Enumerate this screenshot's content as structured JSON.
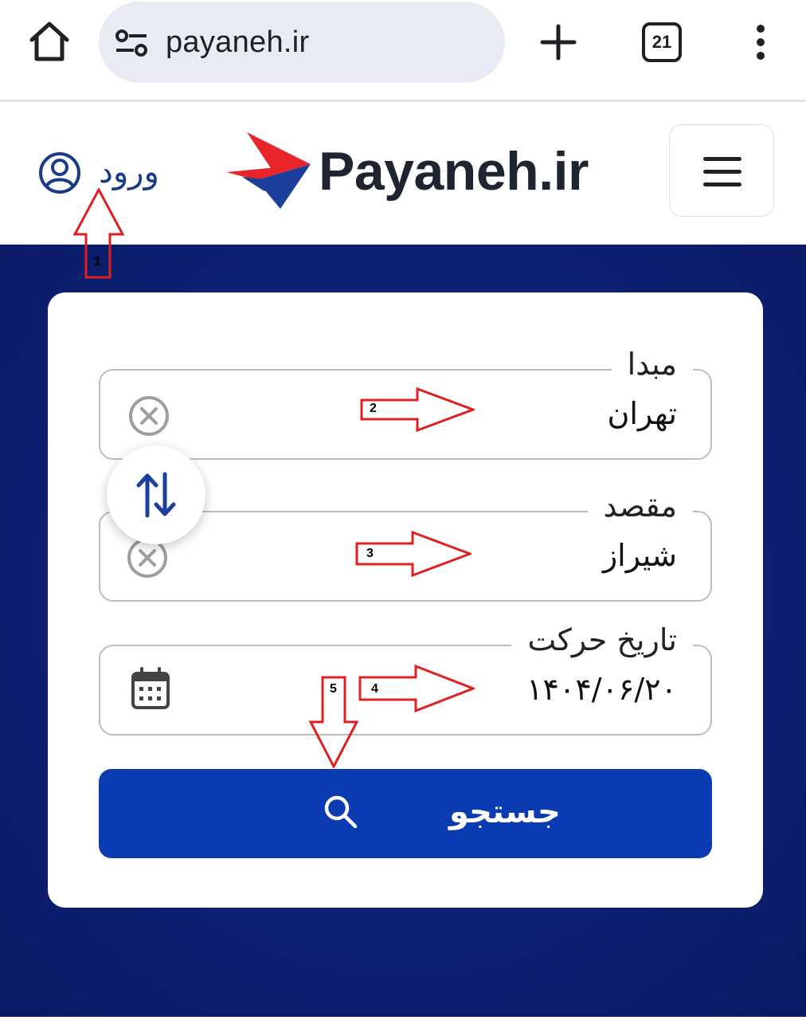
{
  "browser": {
    "url": "payaneh.ir",
    "tab_count": "21"
  },
  "header": {
    "login_label": "ورود",
    "logo_text": "Payaneh.ir"
  },
  "form": {
    "origin_label": "مبدا",
    "origin_value": "تهران",
    "destination_label": "مقصد",
    "destination_value": "شیراز",
    "date_label": "تاریخ حرکت",
    "date_value": "۱۴۰۴/۰۶/۲۰",
    "search_label": "جستجو"
  },
  "annotations": [
    "1",
    "2",
    "3",
    "4",
    "5"
  ],
  "colors": {
    "primary": "#0b3bb0",
    "hero_bg": "#0f2278",
    "annotation": "#e02020",
    "logo_red": "#e8262a",
    "logo_blue": "#1c3f9c"
  }
}
